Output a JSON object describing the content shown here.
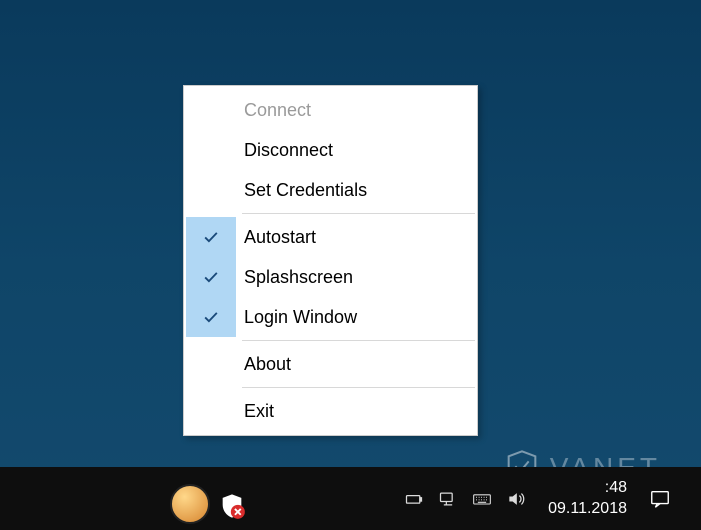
{
  "menu": {
    "connect": "Connect",
    "disconnect": "Disconnect",
    "set_credentials": "Set Credentials",
    "autostart": "Autostart",
    "splashscreen": "Splashscreen",
    "login_window": "Login Window",
    "about": "About",
    "exit": "Exit",
    "states": {
      "connect_enabled": false,
      "autostart_checked": true,
      "splashscreen_checked": true,
      "login_window_checked": true
    }
  },
  "taskbar": {
    "time": ":48",
    "date": "09.11.2018"
  },
  "watermark": {
    "text": "VANET"
  }
}
